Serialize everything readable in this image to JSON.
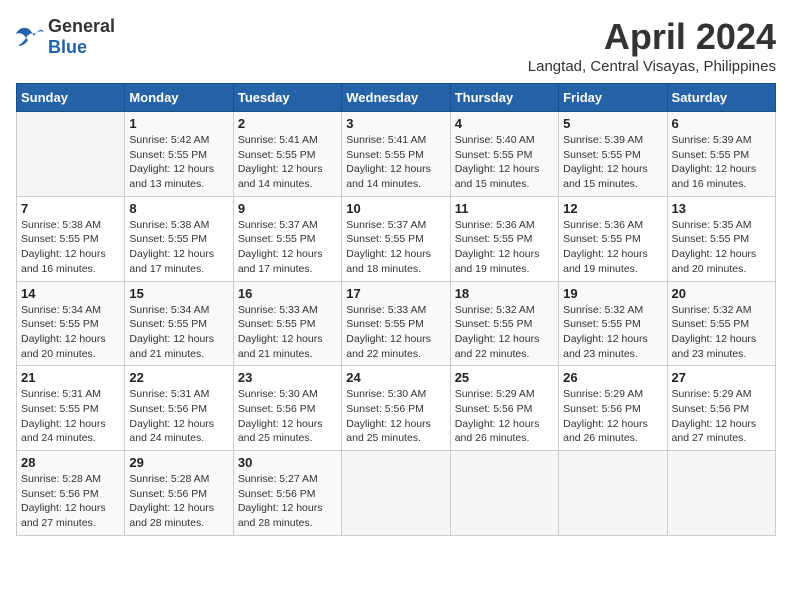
{
  "header": {
    "logo_general": "General",
    "logo_blue": "Blue",
    "month_title": "April 2024",
    "location": "Langtad, Central Visayas, Philippines"
  },
  "days_of_week": [
    "Sunday",
    "Monday",
    "Tuesday",
    "Wednesday",
    "Thursday",
    "Friday",
    "Saturday"
  ],
  "weeks": [
    [
      {
        "day": "",
        "sunrise": "",
        "sunset": "",
        "daylight": ""
      },
      {
        "day": "1",
        "sunrise": "5:42 AM",
        "sunset": "5:55 PM",
        "daylight": "12 hours and 13 minutes."
      },
      {
        "day": "2",
        "sunrise": "5:41 AM",
        "sunset": "5:55 PM",
        "daylight": "12 hours and 14 minutes."
      },
      {
        "day": "3",
        "sunrise": "5:41 AM",
        "sunset": "5:55 PM",
        "daylight": "12 hours and 14 minutes."
      },
      {
        "day": "4",
        "sunrise": "5:40 AM",
        "sunset": "5:55 PM",
        "daylight": "12 hours and 15 minutes."
      },
      {
        "day": "5",
        "sunrise": "5:39 AM",
        "sunset": "5:55 PM",
        "daylight": "12 hours and 15 minutes."
      },
      {
        "day": "6",
        "sunrise": "5:39 AM",
        "sunset": "5:55 PM",
        "daylight": "12 hours and 16 minutes."
      }
    ],
    [
      {
        "day": "7",
        "sunrise": "5:38 AM",
        "sunset": "5:55 PM",
        "daylight": "12 hours and 16 minutes."
      },
      {
        "day": "8",
        "sunrise": "5:38 AM",
        "sunset": "5:55 PM",
        "daylight": "12 hours and 17 minutes."
      },
      {
        "day": "9",
        "sunrise": "5:37 AM",
        "sunset": "5:55 PM",
        "daylight": "12 hours and 17 minutes."
      },
      {
        "day": "10",
        "sunrise": "5:37 AM",
        "sunset": "5:55 PM",
        "daylight": "12 hours and 18 minutes."
      },
      {
        "day": "11",
        "sunrise": "5:36 AM",
        "sunset": "5:55 PM",
        "daylight": "12 hours and 19 minutes."
      },
      {
        "day": "12",
        "sunrise": "5:36 AM",
        "sunset": "5:55 PM",
        "daylight": "12 hours and 19 minutes."
      },
      {
        "day": "13",
        "sunrise": "5:35 AM",
        "sunset": "5:55 PM",
        "daylight": "12 hours and 20 minutes."
      }
    ],
    [
      {
        "day": "14",
        "sunrise": "5:34 AM",
        "sunset": "5:55 PM",
        "daylight": "12 hours and 20 minutes."
      },
      {
        "day": "15",
        "sunrise": "5:34 AM",
        "sunset": "5:55 PM",
        "daylight": "12 hours and 21 minutes."
      },
      {
        "day": "16",
        "sunrise": "5:33 AM",
        "sunset": "5:55 PM",
        "daylight": "12 hours and 21 minutes."
      },
      {
        "day": "17",
        "sunrise": "5:33 AM",
        "sunset": "5:55 PM",
        "daylight": "12 hours and 22 minutes."
      },
      {
        "day": "18",
        "sunrise": "5:32 AM",
        "sunset": "5:55 PM",
        "daylight": "12 hours and 22 minutes."
      },
      {
        "day": "19",
        "sunrise": "5:32 AM",
        "sunset": "5:55 PM",
        "daylight": "12 hours and 23 minutes."
      },
      {
        "day": "20",
        "sunrise": "5:32 AM",
        "sunset": "5:55 PM",
        "daylight": "12 hours and 23 minutes."
      }
    ],
    [
      {
        "day": "21",
        "sunrise": "5:31 AM",
        "sunset": "5:55 PM",
        "daylight": "12 hours and 24 minutes."
      },
      {
        "day": "22",
        "sunrise": "5:31 AM",
        "sunset": "5:56 PM",
        "daylight": "12 hours and 24 minutes."
      },
      {
        "day": "23",
        "sunrise": "5:30 AM",
        "sunset": "5:56 PM",
        "daylight": "12 hours and 25 minutes."
      },
      {
        "day": "24",
        "sunrise": "5:30 AM",
        "sunset": "5:56 PM",
        "daylight": "12 hours and 25 minutes."
      },
      {
        "day": "25",
        "sunrise": "5:29 AM",
        "sunset": "5:56 PM",
        "daylight": "12 hours and 26 minutes."
      },
      {
        "day": "26",
        "sunrise": "5:29 AM",
        "sunset": "5:56 PM",
        "daylight": "12 hours and 26 minutes."
      },
      {
        "day": "27",
        "sunrise": "5:29 AM",
        "sunset": "5:56 PM",
        "daylight": "12 hours and 27 minutes."
      }
    ],
    [
      {
        "day": "28",
        "sunrise": "5:28 AM",
        "sunset": "5:56 PM",
        "daylight": "12 hours and 27 minutes."
      },
      {
        "day": "29",
        "sunrise": "5:28 AM",
        "sunset": "5:56 PM",
        "daylight": "12 hours and 28 minutes."
      },
      {
        "day": "30",
        "sunrise": "5:27 AM",
        "sunset": "5:56 PM",
        "daylight": "12 hours and 28 minutes."
      },
      {
        "day": "",
        "sunrise": "",
        "sunset": "",
        "daylight": ""
      },
      {
        "day": "",
        "sunrise": "",
        "sunset": "",
        "daylight": ""
      },
      {
        "day": "",
        "sunrise": "",
        "sunset": "",
        "daylight": ""
      },
      {
        "day": "",
        "sunrise": "",
        "sunset": "",
        "daylight": ""
      }
    ]
  ]
}
